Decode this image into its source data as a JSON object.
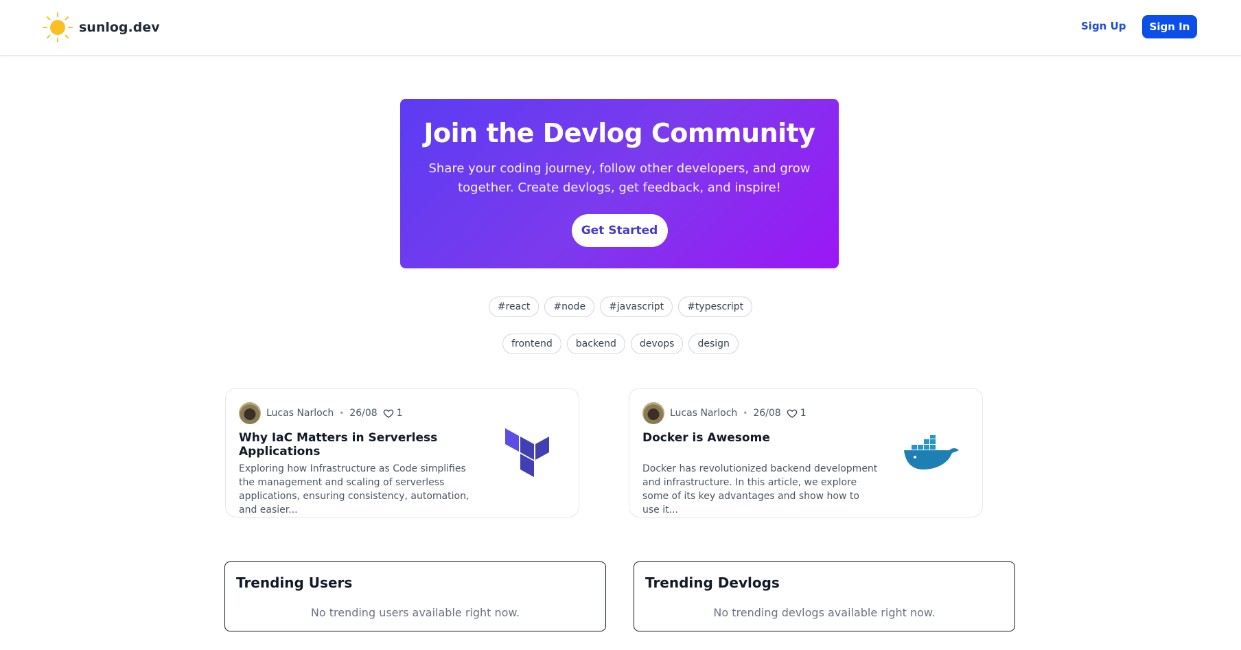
{
  "header": {
    "logo_text": "sunlog.dev",
    "signup_label": "Sign Up",
    "signin_label": "Sign In"
  },
  "hero": {
    "title": "Join the Devlog Community",
    "subtitle": "Share your coding journey, follow other developers, and grow together. Create devlogs, get feedback, and inspire!",
    "cta_label": "Get Started"
  },
  "tags_row1": [
    "#react",
    "#node",
    "#javascript",
    "#typescript"
  ],
  "tags_row2": [
    "frontend",
    "backend",
    "devops",
    "design"
  ],
  "devlogs": [
    {
      "author": "Lucas Narloch",
      "date": "26/08",
      "likes": "1",
      "title": "Why IaC Matters in Serverless Applications",
      "excerpt": "Exploring how Infrastructure as Code simplifies the management and scaling of serverless applications, ensuring consistency, automation, and easier...",
      "image_icon": "terraform-logo-icon"
    },
    {
      "author": "Lucas Narloch",
      "date": "26/08",
      "likes": "1",
      "title": "Docker is Awesome",
      "excerpt": "Docker has revolutionized backend development and infrastructure. In this article, we explore some of its key advantages and show how to use it...",
      "image_icon": "docker-logo-icon"
    }
  ],
  "trending_users": {
    "title": "Trending Users",
    "empty_text": "No trending users available right now."
  },
  "trending_devlogs": {
    "title": "Trending Devlogs",
    "empty_text": "No trending devlogs available right now."
  },
  "colors": {
    "brand_blue": "#0b4ee8",
    "hero_gradient_start": "#5b3cf3",
    "hero_gradient_end": "#9b17f5",
    "sun": "#fbbf24"
  }
}
